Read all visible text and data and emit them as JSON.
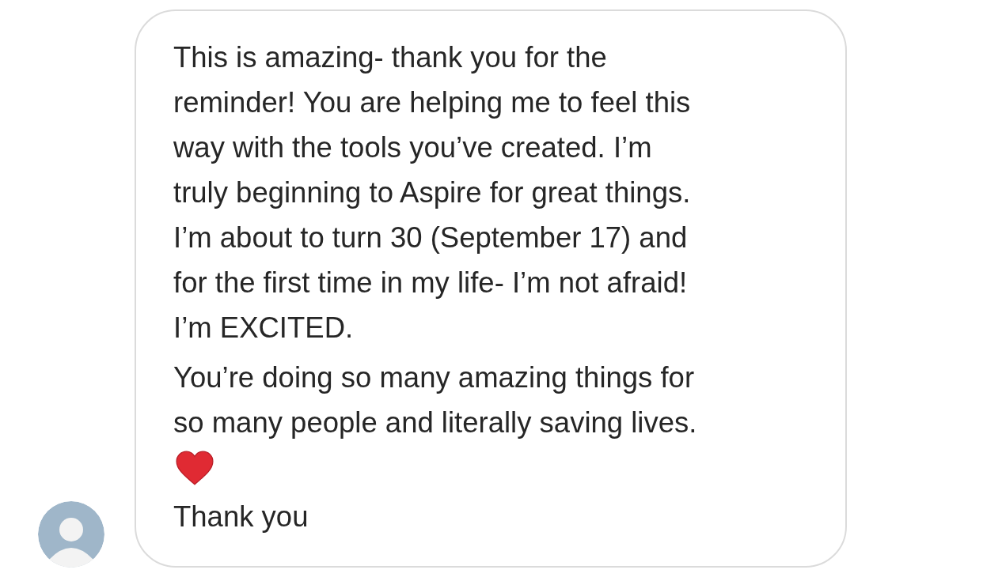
{
  "message": {
    "blocks": [
      {
        "kind": "text",
        "text": "This is amazing- thank you for the\nreminder! You are helping me to feel this\nway with the tools you’ve created. I’m\ntruly beginning to Aspire for great things.\nI’m about to turn 30 (September 17) and\nfor the first time in my life- I’m not afraid!\nI’m EXCITED."
      },
      {
        "kind": "text",
        "text": "You’re doing so many amazing things for\nso many people and literally saving lives."
      },
      {
        "kind": "heart"
      },
      {
        "kind": "text",
        "text": "Thank you"
      }
    ]
  }
}
